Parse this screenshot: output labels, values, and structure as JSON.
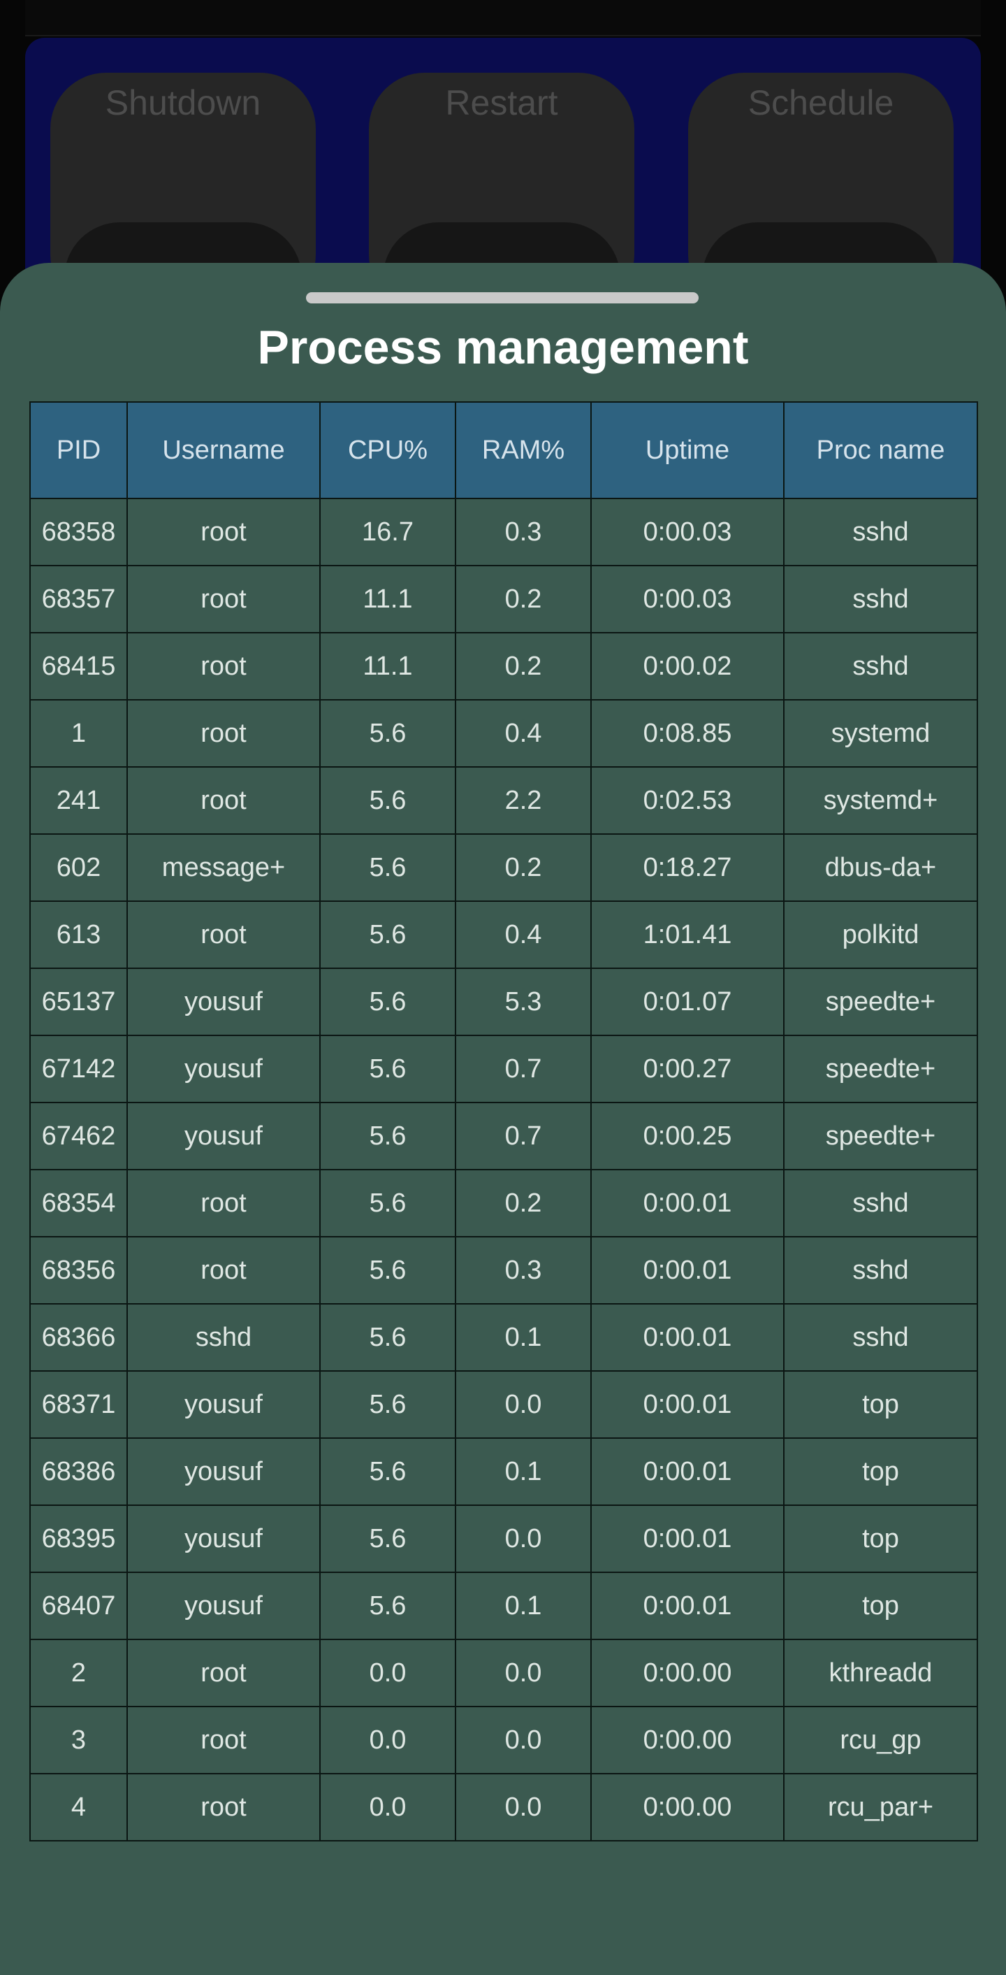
{
  "background_app": {
    "buttons": [
      "Shutdown",
      "Restart",
      "Schedule"
    ]
  },
  "sheet": {
    "title": "Process management"
  },
  "table": {
    "columns": [
      "PID",
      "Username",
      "CPU%",
      "RAM%",
      "Uptime",
      "Proc name"
    ],
    "rows": [
      [
        "68358",
        "root",
        "16.7",
        "0.3",
        "0:00.03",
        "sshd"
      ],
      [
        "68357",
        "root",
        "11.1",
        "0.2",
        "0:00.03",
        "sshd"
      ],
      [
        "68415",
        "root",
        "11.1",
        "0.2",
        "0:00.02",
        "sshd"
      ],
      [
        "1",
        "root",
        "5.6",
        "0.4",
        "0:08.85",
        "systemd"
      ],
      [
        "241",
        "root",
        "5.6",
        "2.2",
        "0:02.53",
        "systemd+"
      ],
      [
        "602",
        "message+",
        "5.6",
        "0.2",
        "0:18.27",
        "dbus-da+"
      ],
      [
        "613",
        "root",
        "5.6",
        "0.4",
        "1:01.41",
        "polkitd"
      ],
      [
        "65137",
        "yousuf",
        "5.6",
        "5.3",
        "0:01.07",
        "speedte+"
      ],
      [
        "67142",
        "yousuf",
        "5.6",
        "0.7",
        "0:00.27",
        "speedte+"
      ],
      [
        "67462",
        "yousuf",
        "5.6",
        "0.7",
        "0:00.25",
        "speedte+"
      ],
      [
        "68354",
        "root",
        "5.6",
        "0.2",
        "0:00.01",
        "sshd"
      ],
      [
        "68356",
        "root",
        "5.6",
        "0.3",
        "0:00.01",
        "sshd"
      ],
      [
        "68366",
        "sshd",
        "5.6",
        "0.1",
        "0:00.01",
        "sshd"
      ],
      [
        "68371",
        "yousuf",
        "5.6",
        "0.0",
        "0:00.01",
        "top"
      ],
      [
        "68386",
        "yousuf",
        "5.6",
        "0.1",
        "0:00.01",
        "top"
      ],
      [
        "68395",
        "yousuf",
        "5.6",
        "0.0",
        "0:00.01",
        "top"
      ],
      [
        "68407",
        "yousuf",
        "5.6",
        "0.1",
        "0:00.01",
        "top"
      ],
      [
        "2",
        "root",
        "0.0",
        "0.0",
        "0:00.00",
        "kthreadd"
      ],
      [
        "3",
        "root",
        "0.0",
        "0.0",
        "0:00.00",
        "rcu_gp"
      ],
      [
        "4",
        "root",
        "0.0",
        "0.0",
        "0:00.00",
        "rcu_par+"
      ]
    ]
  },
  "colors": {
    "sheet_bg": "#3b5a50",
    "header_bg": "#2e6280",
    "background_panel": "#0a0c4e"
  }
}
